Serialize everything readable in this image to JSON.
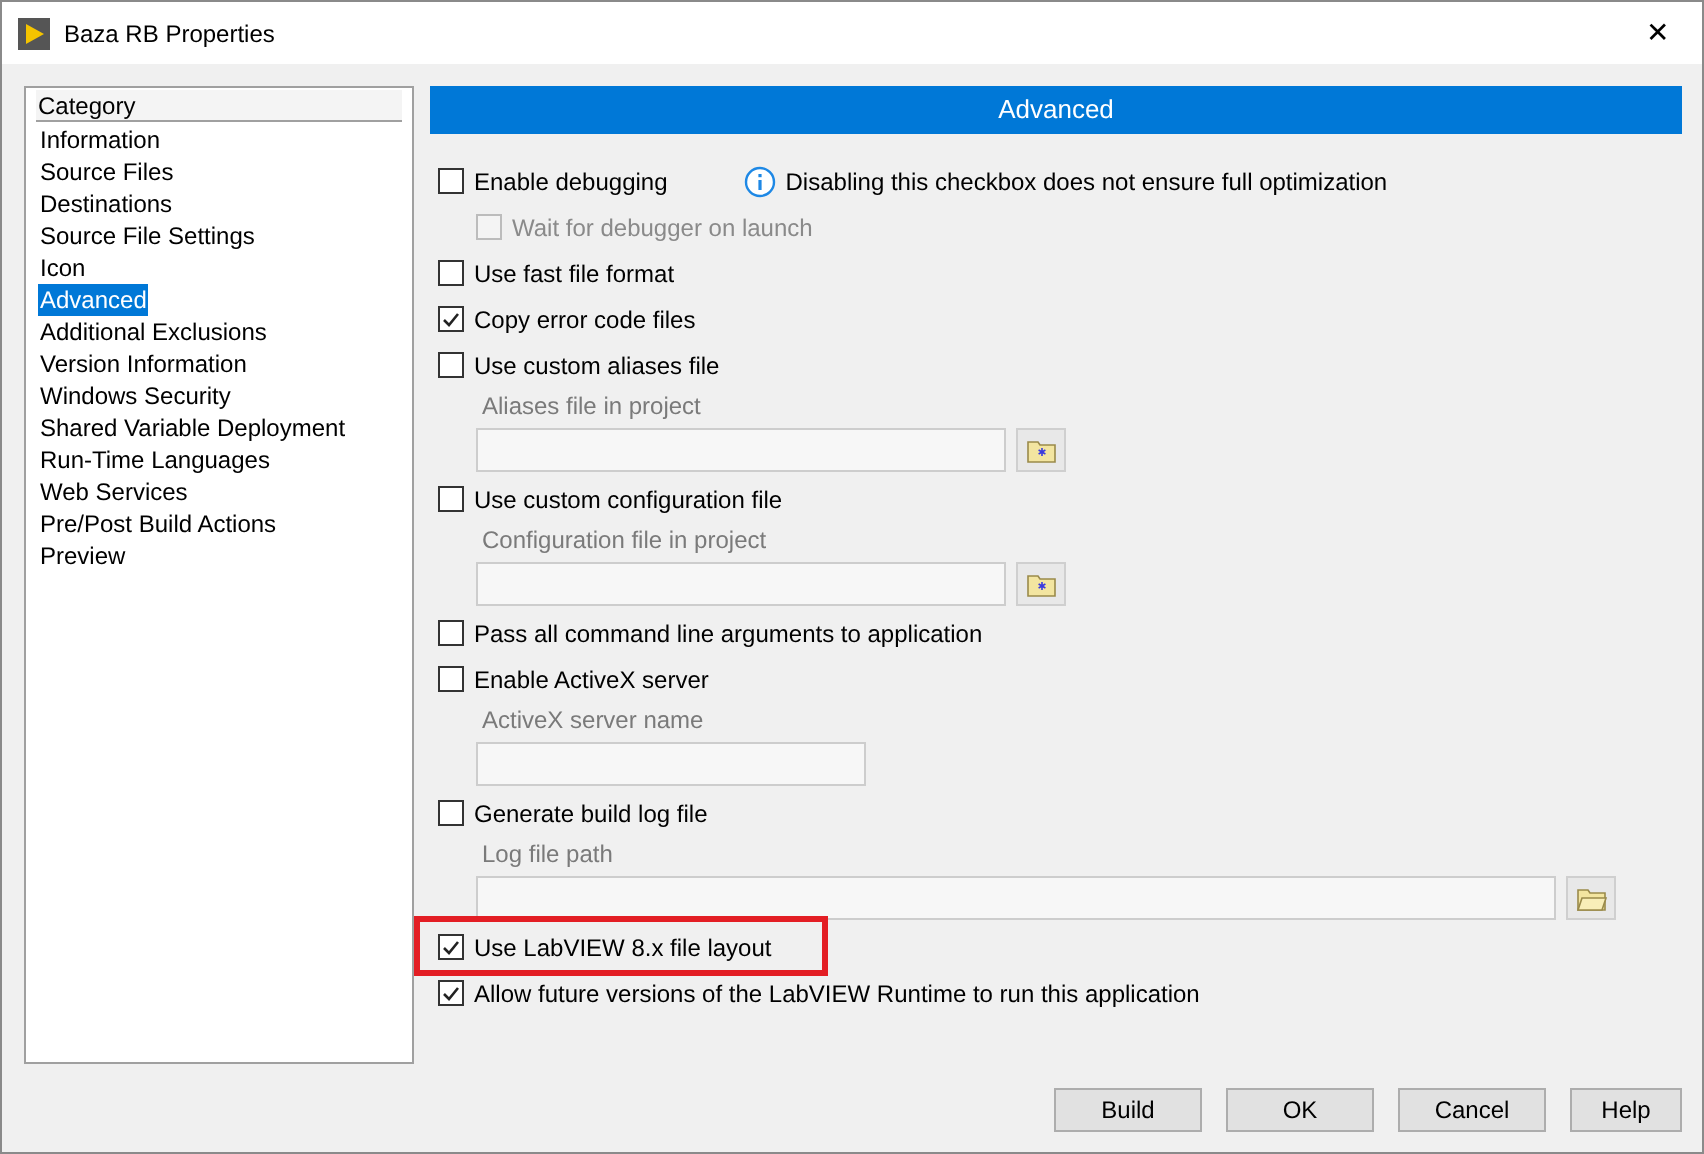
{
  "window": {
    "title": "Baza RB Properties",
    "close": "✕"
  },
  "category_list": {
    "header": "Category",
    "items": [
      {
        "label": "Information",
        "selected": false
      },
      {
        "label": "Source Files",
        "selected": false
      },
      {
        "label": "Destinations",
        "selected": false
      },
      {
        "label": "Source File Settings",
        "selected": false
      },
      {
        "label": "Icon",
        "selected": false
      },
      {
        "label": "Advanced",
        "selected": true
      },
      {
        "label": "Additional Exclusions",
        "selected": false
      },
      {
        "label": "Version Information",
        "selected": false
      },
      {
        "label": "Windows Security",
        "selected": false
      },
      {
        "label": "Shared Variable Deployment",
        "selected": false
      },
      {
        "label": "Run-Time Languages",
        "selected": false
      },
      {
        "label": "Web Services",
        "selected": false
      },
      {
        "label": "Pre/Post Build Actions",
        "selected": false
      },
      {
        "label": "Preview",
        "selected": false
      }
    ]
  },
  "panel": {
    "title": "Advanced",
    "options": [
      {
        "kind": "checkbox",
        "label": "Enable debugging",
        "checked": false,
        "disabled": false,
        "highlighted": false,
        "note": "Disabling this checkbox does not ensure full optimization",
        "children": [
          {
            "kind": "checkbox",
            "label": "Wait for debugger on launch",
            "checked": false,
            "disabled": true,
            "highlighted": false
          }
        ]
      },
      {
        "kind": "checkbox",
        "label": "Use fast file format",
        "checked": false,
        "disabled": false,
        "highlighted": false
      },
      {
        "kind": "checkbox",
        "label": "Copy error code files",
        "checked": true,
        "disabled": false,
        "highlighted": false
      },
      {
        "kind": "checkbox",
        "label": "Use custom aliases file",
        "checked": false,
        "disabled": false,
        "highlighted": false,
        "children": [
          {
            "kind": "project_path",
            "label": "Aliases file in project"
          }
        ]
      },
      {
        "kind": "checkbox",
        "label": "Use custom configuration file",
        "checked": false,
        "disabled": false,
        "highlighted": false,
        "children": [
          {
            "kind": "project_path",
            "label": "Configuration file in project"
          }
        ]
      },
      {
        "kind": "checkbox",
        "label": "Pass all command line arguments to application",
        "checked": false,
        "disabled": false,
        "highlighted": false
      },
      {
        "kind": "checkbox",
        "label": "Enable ActiveX server",
        "checked": false,
        "disabled": false,
        "highlighted": false,
        "children": [
          {
            "kind": "text_field",
            "label": "ActiveX server name"
          }
        ]
      },
      {
        "kind": "checkbox",
        "label": "Generate build log file",
        "checked": false,
        "disabled": false,
        "highlighted": false,
        "children": [
          {
            "kind": "file_path",
            "label": "Log file path"
          }
        ]
      },
      {
        "kind": "checkbox",
        "label": "Use LabVIEW 8.x file layout",
        "checked": true,
        "disabled": false,
        "highlighted": true
      },
      {
        "kind": "checkbox",
        "label": "Allow future versions of the LabVIEW Runtime to run this application",
        "checked": true,
        "disabled": false,
        "highlighted": false
      }
    ]
  },
  "buttons": [
    "Build",
    "OK",
    "Cancel",
    "Help"
  ]
}
